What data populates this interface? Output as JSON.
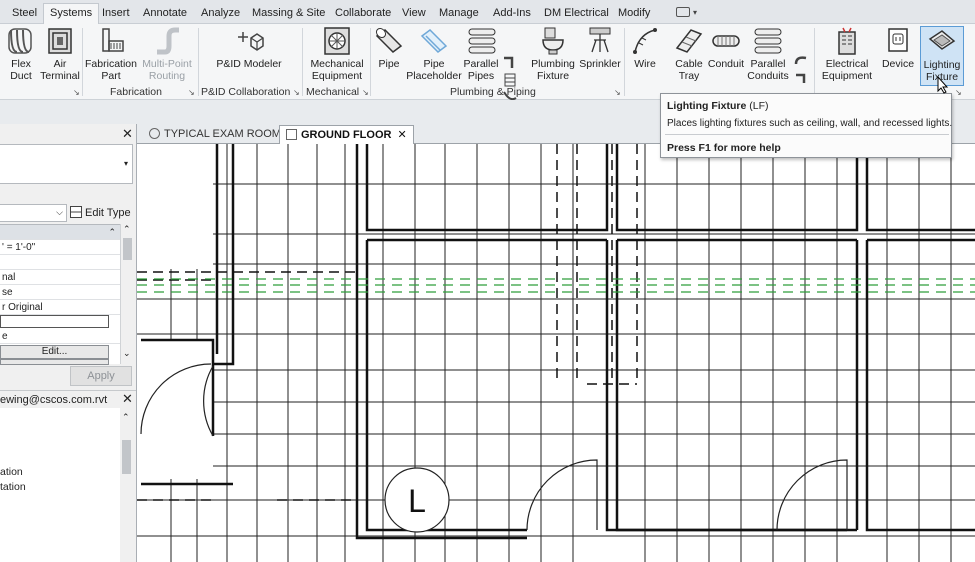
{
  "menu": {
    "tabs": [
      {
        "label": "Steel",
        "active": false
      },
      {
        "label": "Systems",
        "active": true
      },
      {
        "label": "Insert",
        "active": false
      },
      {
        "label": "Annotate",
        "active": false
      },
      {
        "label": "Analyze",
        "active": false
      },
      {
        "label": "Massing & Site",
        "active": false
      },
      {
        "label": "Collaborate",
        "active": false
      },
      {
        "label": "View",
        "active": false
      },
      {
        "label": "Manage",
        "active": false
      },
      {
        "label": "Add-Ins",
        "active": false
      },
      {
        "label": "DM Electrical",
        "active": false
      },
      {
        "label": "Modify",
        "active": false
      }
    ]
  },
  "ribbon": {
    "buttons": {
      "flex_duct": "Flex\nDuct",
      "air_terminal": "Air\nTerminal",
      "fabrication_part": "Fabrication\nPart",
      "multi_point_routing": "Multi-Point\nRouting",
      "pid_modeler": "P&ID Modeler",
      "mechanical_equipment": "Mechanical\nEquipment",
      "pipe": "Pipe",
      "pipe_placeholder": "Pipe\nPlaceholder",
      "parallel_pipes": "Parallel\nPipes",
      "plumbing_fixture": "Plumbing\nFixture",
      "sprinkler": "Sprinkler",
      "wire": "Wire",
      "cable_tray": "Cable\nTray",
      "conduit": "Conduit",
      "parallel_conduits": "Parallel\nConduits",
      "electrical_equipment": "Electrical\nEquipment",
      "device": "Device",
      "lighting_fixture": "Lighting\nFixture"
    },
    "groups": {
      "fabrication": "Fabrication",
      "pid_collaboration": "P&ID Collaboration",
      "mechanical": "Mechanical",
      "plumbing_piping": "Plumbing & Piping"
    }
  },
  "properties": {
    "edit_type": "Edit Type",
    "rows": {
      "scale": "' = 1'-0\"",
      "r1": "nal",
      "r2": "se",
      "r3": "r Original",
      "r4": "e"
    },
    "edit_label": "Edit...",
    "edit_partial": "Edit...",
    "apply": "Apply"
  },
  "project_browser": {
    "title": "ewing@cscos.com.rvt",
    "items": [
      "ation",
      "tation"
    ]
  },
  "view_tabs": [
    {
      "label": "TYPICAL EXAM ROOM",
      "active": false
    },
    {
      "label": "GROUND FLOOR",
      "active": true
    }
  ],
  "drawing": {
    "tag_letter": "L"
  },
  "tooltip": {
    "title": "Lighting Fixture",
    "shortcut": "(LF)",
    "description": "Places lighting fixtures such as ceiling, wall, and recessed lights.",
    "help": "Press F1 for more help"
  },
  "colors": {
    "accent_blue": "#5b9bd5",
    "ribbon_bg": "#f5f6f7",
    "green_dash": "#2e9e3a"
  }
}
